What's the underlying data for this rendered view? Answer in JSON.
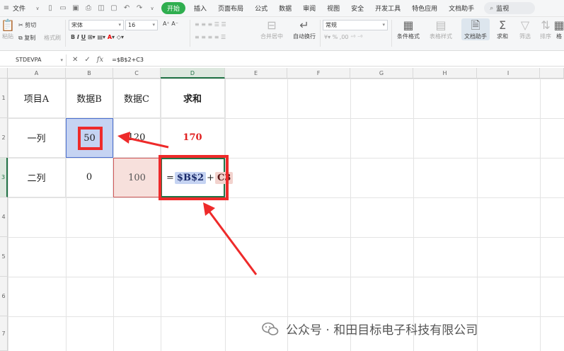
{
  "menu": {
    "file": "文件",
    "tabs": [
      "开始",
      "插入",
      "页面布局",
      "公式",
      "数据",
      "审阅",
      "视图",
      "安全",
      "开发工具",
      "特色应用",
      "文档助手"
    ],
    "active_tab": "开始",
    "search_placeholder": "监视"
  },
  "ribbon": {
    "cut": "剪切",
    "copy": "复制",
    "paste": "粘贴",
    "format_painter": "格式刷",
    "font_name": "宋体",
    "font_size": "16",
    "merge_center": "合并居中",
    "wrap_text": "自动换行",
    "number_format": "常规",
    "conditional_format": "条件格式",
    "table_style": "表格样式",
    "doc_assistant": "文档助手",
    "sum": "求和",
    "filter": "筛选",
    "sort": "排序",
    "format_cut": "格"
  },
  "formula_bar": {
    "name_box": "STDEVPA",
    "fx": "fx",
    "formula": "=$B$2+C3"
  },
  "columns": [
    "A",
    "B",
    "C",
    "D",
    "E",
    "F",
    "G",
    "H",
    "I"
  ],
  "rows": [
    "1",
    "2",
    "3",
    "4",
    "5",
    "6",
    "7"
  ],
  "cells": {
    "A1": "项目A",
    "B1": "数据B",
    "C1": "数据C",
    "D1": "求和",
    "A2": "一列",
    "B2": "50",
    "C2": "120",
    "D2": "170",
    "A3": "二列",
    "B3": "0",
    "C3": "100",
    "D3_eq": "=",
    "D3_ref1": "$B$2",
    "D3_plus": "+",
    "D3_ref2": "C3"
  },
  "watermark": "公众号 · 和田目标电子科技有限公司",
  "colors": {
    "accent": "#2fae4f",
    "annotation": "#ee2a2a",
    "sel_blue": "#c5d3f2",
    "sel_red": "#f2d2cd"
  }
}
